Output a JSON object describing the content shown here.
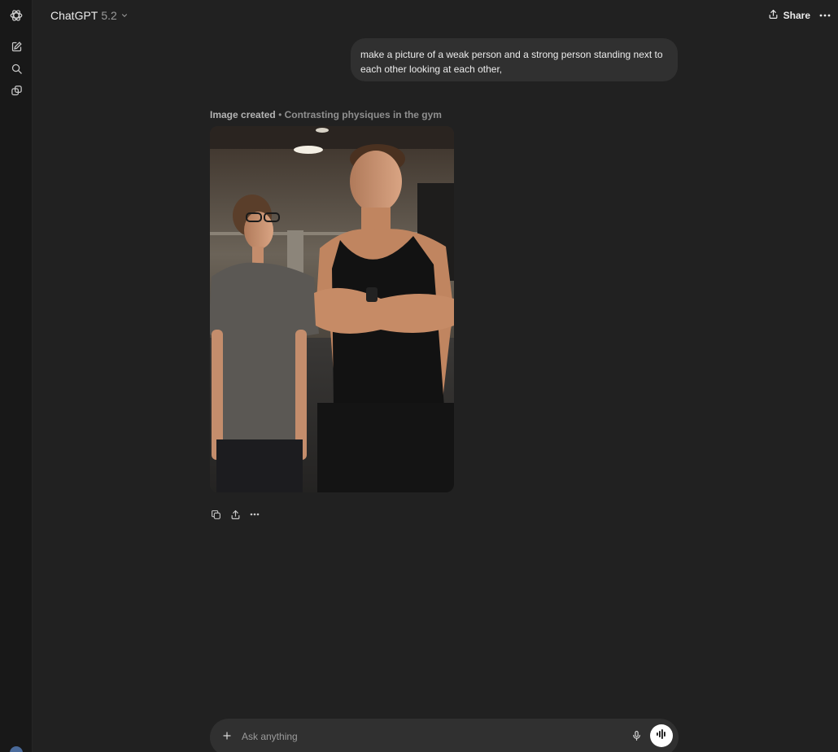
{
  "header": {
    "model_name": "ChatGPT",
    "model_version": "5.2",
    "share_label": "Share"
  },
  "sidebar": {
    "icons": [
      "openai-logo-icon",
      "new-chat-icon",
      "search-icon",
      "library-icon"
    ]
  },
  "conversation": {
    "user_message": "make a picture of a weak person and a strong person standing next to each other looking at each other,",
    "image_caption_label": "Image created",
    "image_caption_separator": "•",
    "image_caption_title": "Contrasting physiques in the gym"
  },
  "composer": {
    "placeholder": "Ask anything"
  },
  "colors": {
    "background": "#212121",
    "sidebar": "#181818",
    "bubble": "#303030",
    "text": "#ececec",
    "muted": "#9b9b9b"
  }
}
